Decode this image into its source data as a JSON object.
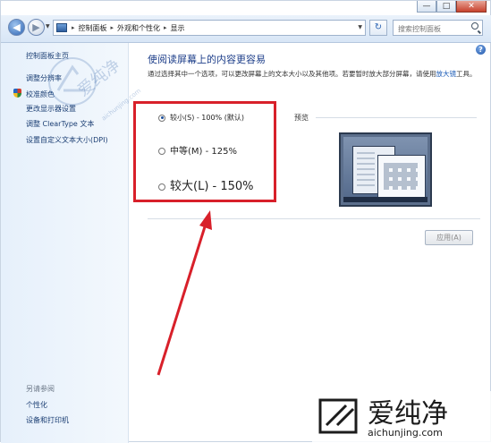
{
  "window": {
    "controls": {
      "minimize": "—",
      "maximize": "□",
      "close": "✕"
    }
  },
  "navbar": {
    "breadcrumbs": [
      "控制面板",
      "外观和个性化",
      "显示"
    ],
    "search_placeholder": "搜索控制面板"
  },
  "sidebar": {
    "home": "控制面板主页",
    "links": [
      "调整分辨率",
      "校准颜色",
      "更改显示器设置",
      "调整 ClearType 文本",
      "设置自定义文本大小(DPI)"
    ],
    "see_also_heading": "另请参阅",
    "see_also_links": [
      "个性化",
      "设备和打印机"
    ]
  },
  "main": {
    "title": "使阅读屏幕上的内容更容易",
    "intro_text": "通过选择其中一个选项，可以更改屏幕上的文本大小以及其他项。若要暂时放大部分屏幕，请使用",
    "intro_link": "放大镜",
    "intro_suffix": "工具。",
    "options": [
      {
        "label": "较小(S) - 100% (默认)",
        "selected": true
      },
      {
        "label": "中等(M) - 125%",
        "selected": false
      },
      {
        "label": "较大(L) - 150%",
        "selected": false
      }
    ],
    "preview_label": "预览",
    "apply_button": "应用(A)"
  },
  "annotation": {
    "highlight_color": "#d8202a"
  },
  "watermark": {
    "text": "爱纯净",
    "url": "aichunjing.com",
    "logo_url": "aichunjing.com"
  }
}
